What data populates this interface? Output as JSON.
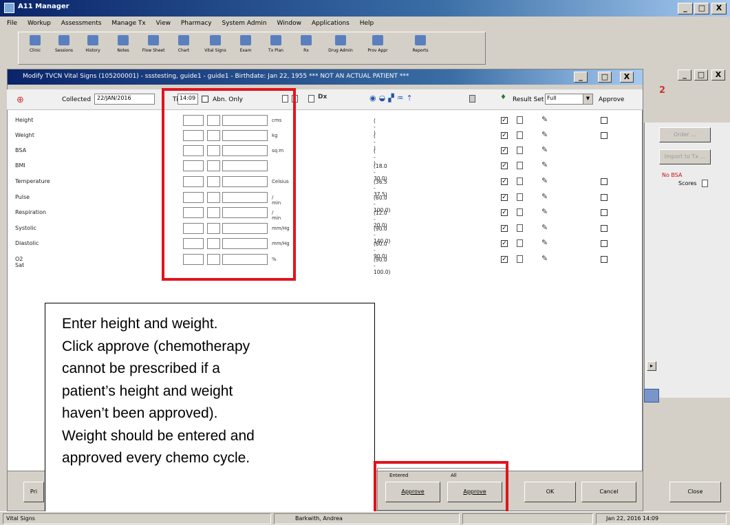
{
  "app": {
    "title": "A11 Manager",
    "controls": [
      "_",
      "□",
      "X"
    ]
  },
  "menu": [
    "File",
    "Workup",
    "Assessments",
    "Manage Tx",
    "View",
    "Pharmacy",
    "System Admin",
    "Window",
    "Applications",
    "Help"
  ],
  "toolbar": [
    "Clinic",
    "Sessions",
    "History",
    "Notes",
    "Flow Sheet",
    "Chart",
    "Vital Signs",
    "Exam",
    "Tx Plan",
    "Rx",
    "Drug Admin",
    "Prov Appr",
    "Reports"
  ],
  "child": {
    "title": "Modify TVCN Vital Signs (105200001) - ssstesting, guide1 - guide1 - Birthdate: Jan 22, 1955 *** NOT AN ACTUAL PATIENT ***"
  },
  "header": {
    "collected_label": "Collected",
    "collected_value": "22/JAN/2016",
    "time_label": "Time",
    "time_value": "14:09",
    "abn_label": "Abn. Only",
    "result_set_label": "Result Set",
    "result_set_value": "Full",
    "approve_label": "Approve"
  },
  "rows": [
    {
      "label": "Height",
      "unit": "cms",
      "range": "( - )"
    },
    {
      "label": "Weight",
      "unit": "kg",
      "range": "( - )"
    },
    {
      "label": "BSA",
      "unit": "sq.m",
      "range": "( - )"
    },
    {
      "label": "BMI",
      "unit": "",
      "range": "(18.0 - 30.0)"
    },
    {
      "label": "Temperature",
      "unit": "Celsius",
      "range": "(36.5 - 37.5)"
    },
    {
      "label": "Pulse",
      "unit": "/ min",
      "range": "(60.0 - 100.0)"
    },
    {
      "label": "Respiration",
      "unit": "/ min",
      "range": "(12.0 - 20.0)"
    },
    {
      "label": "Systolic",
      "unit": "mm/Hg",
      "range": "(90.0 - 140.0)"
    },
    {
      "label": "Diastolic",
      "unit": "mm/Hg",
      "range": "(60.0 - 90.0)"
    },
    {
      "label": "O2 Sat",
      "unit": "%",
      "range": "(90.0 - 100.0)"
    }
  ],
  "callout": [
    "Enter height and weight.",
    "Click approve (chemotherapy",
    "cannot be prescribed if a",
    "patient’s height and weight",
    "haven’t been approved).",
    "Weight should be entered and",
    "approved every chemo cycle."
  ],
  "buttons": {
    "entered_label": "Entered",
    "all_label": "All",
    "approve_entered": "Approve",
    "approve_all": "Approve",
    "ok": "OK",
    "cancel": "Cancel",
    "close": "Close",
    "print": "Pri"
  },
  "right_panel": {
    "order": "Order ...",
    "refer": "Import to Tx ...",
    "no_bsa": "No BSA",
    "scores": "Scores"
  },
  "status": {
    "left": "Vital Signs",
    "user": "Barkwith, Andrea",
    "date": "Jan 22, 2016 14:09"
  }
}
